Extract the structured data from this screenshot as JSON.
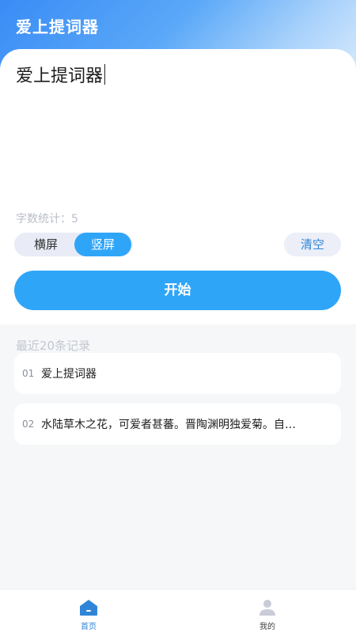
{
  "app": {
    "title": "爱上提词器"
  },
  "editor": {
    "text": "爱上提词器",
    "word_count_label": "字数统计：5"
  },
  "orientation": {
    "options": [
      "横屏",
      "竖屏"
    ],
    "selected": "竖屏"
  },
  "actions": {
    "clear_label": "清空",
    "start_label": "开始"
  },
  "recent": {
    "title": "最近20条记录",
    "items": [
      {
        "index": "01",
        "text": "爱上提词器"
      },
      {
        "index": "02",
        "text": "水陆草木之花，可爱者甚蕃。晋陶渊明独爱菊。自…"
      }
    ]
  },
  "tabbar": {
    "items": [
      {
        "label": "首页",
        "icon": "home-icon",
        "active": true
      },
      {
        "label": "我的",
        "icon": "user-icon",
        "active": false
      }
    ]
  },
  "colors": {
    "accent": "#2fa5f8",
    "header_gradient_start": "#3a8cf6",
    "active_tab": "#2f86d8"
  }
}
